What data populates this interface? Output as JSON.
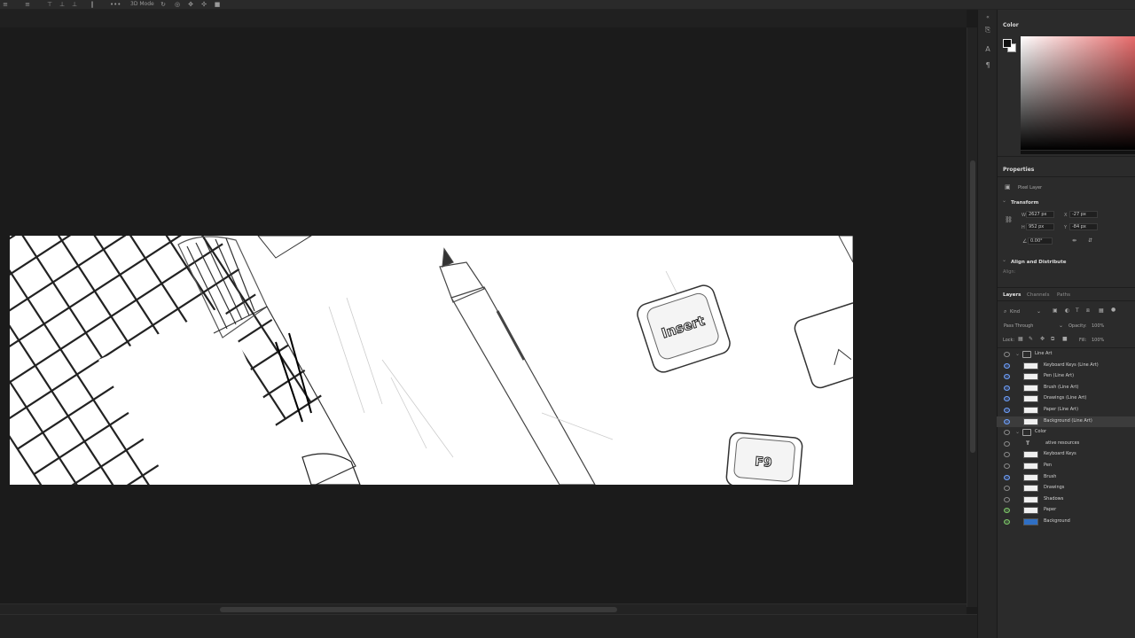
{
  "toolbar": {
    "mode_label": "3D Mode",
    "more_icon": "ellipsis-icon"
  },
  "canvas": {
    "key_insert": "Insert",
    "key_f9": "F9"
  },
  "color_panel": {
    "title": "Color",
    "fg": "#111111",
    "bg": "#ffffff",
    "accent": "#e66a6a"
  },
  "properties": {
    "title": "Properties",
    "layer_kind": "Pixel Layer",
    "transform_title": "Transform",
    "w_label": "W",
    "w_value": "2627 px",
    "x_label": "X",
    "x_value": "-27 px",
    "h_label": "H",
    "h_value": "952 px",
    "y_label": "Y",
    "y_value": "-84 px",
    "angle_value": "0.00°",
    "align_title": "Align and Distribute",
    "align_sub": "Align:"
  },
  "layers_panel": {
    "tabs": [
      "Layers",
      "Channels",
      "Paths"
    ],
    "filter_label": "Kind",
    "blend_mode": "Pass Through",
    "opacity_label": "Opacity:",
    "opacity_value": "100%",
    "lock_label": "Lock:",
    "fill_label": "Fill:",
    "fill_value": "100%",
    "layers": [
      {
        "name": "Line Art",
        "kind": "group",
        "eye": "grey"
      },
      {
        "name": "Keyboard Keys (Line Art)",
        "kind": "pixel",
        "eye": "blue"
      },
      {
        "name": "Pen (Line Art)",
        "kind": "pixel",
        "eye": "blue"
      },
      {
        "name": "Brush (Line Art)",
        "kind": "pixel",
        "eye": "blue"
      },
      {
        "name": "Drawings (Line Art)",
        "kind": "pixel",
        "eye": "blue"
      },
      {
        "name": "Paper (Line Art)",
        "kind": "pixel",
        "eye": "blue"
      },
      {
        "name": "Background (Line Art)",
        "kind": "pixel",
        "eye": "blue",
        "selected": true
      },
      {
        "name": "Color",
        "kind": "group",
        "eye": "grey"
      },
      {
        "name": "ative resources",
        "kind": "text",
        "eye": "grey"
      },
      {
        "name": "Keyboard Keys",
        "kind": "pixel",
        "eye": "grey"
      },
      {
        "name": "Pen",
        "kind": "pixel",
        "eye": "grey"
      },
      {
        "name": "Brush",
        "kind": "pixel",
        "eye": "blue"
      },
      {
        "name": "Drawings",
        "kind": "pixel",
        "eye": "grey"
      },
      {
        "name": "Shadows",
        "kind": "pixel",
        "eye": "grey"
      },
      {
        "name": "Paper",
        "kind": "pixel",
        "eye": "green"
      },
      {
        "name": "Background",
        "kind": "fill",
        "eye": "green"
      }
    ]
  }
}
